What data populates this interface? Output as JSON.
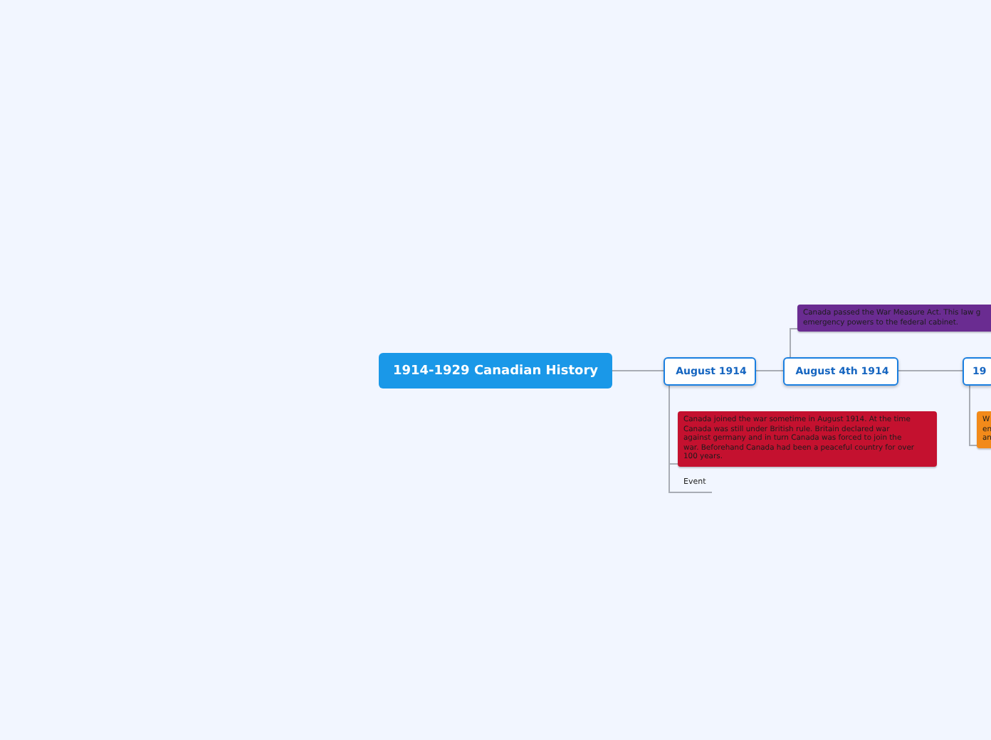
{
  "central_topic": "1914-1929 Canadian History",
  "topics": [
    {
      "label": "August 1914",
      "children": [
        {
          "kind": "note",
          "color": "#c4112f",
          "lines": [
            "Canada joined the war sometime in August 1914. At the time",
            "Canada was still under British rule. Britain declared war",
            "against germany and in turn Canada was forced to join the",
            "war. Beforehand Canada had been a peaceful country for over",
            "100 years."
          ]
        },
        {
          "kind": "label",
          "text": "Event"
        }
      ]
    },
    {
      "label": "August 4th 1914",
      "children": [
        {
          "kind": "note",
          "color": "#6a2c91",
          "lines": [
            "Canada passed the War Measure Act. This law g",
            "emergency powers to the federal cabinet."
          ]
        }
      ]
    },
    {
      "label": "19",
      "children": [
        {
          "kind": "note",
          "color": "#f28a1a",
          "lines": [
            "W",
            "en",
            "an"
          ]
        }
      ]
    }
  ]
}
